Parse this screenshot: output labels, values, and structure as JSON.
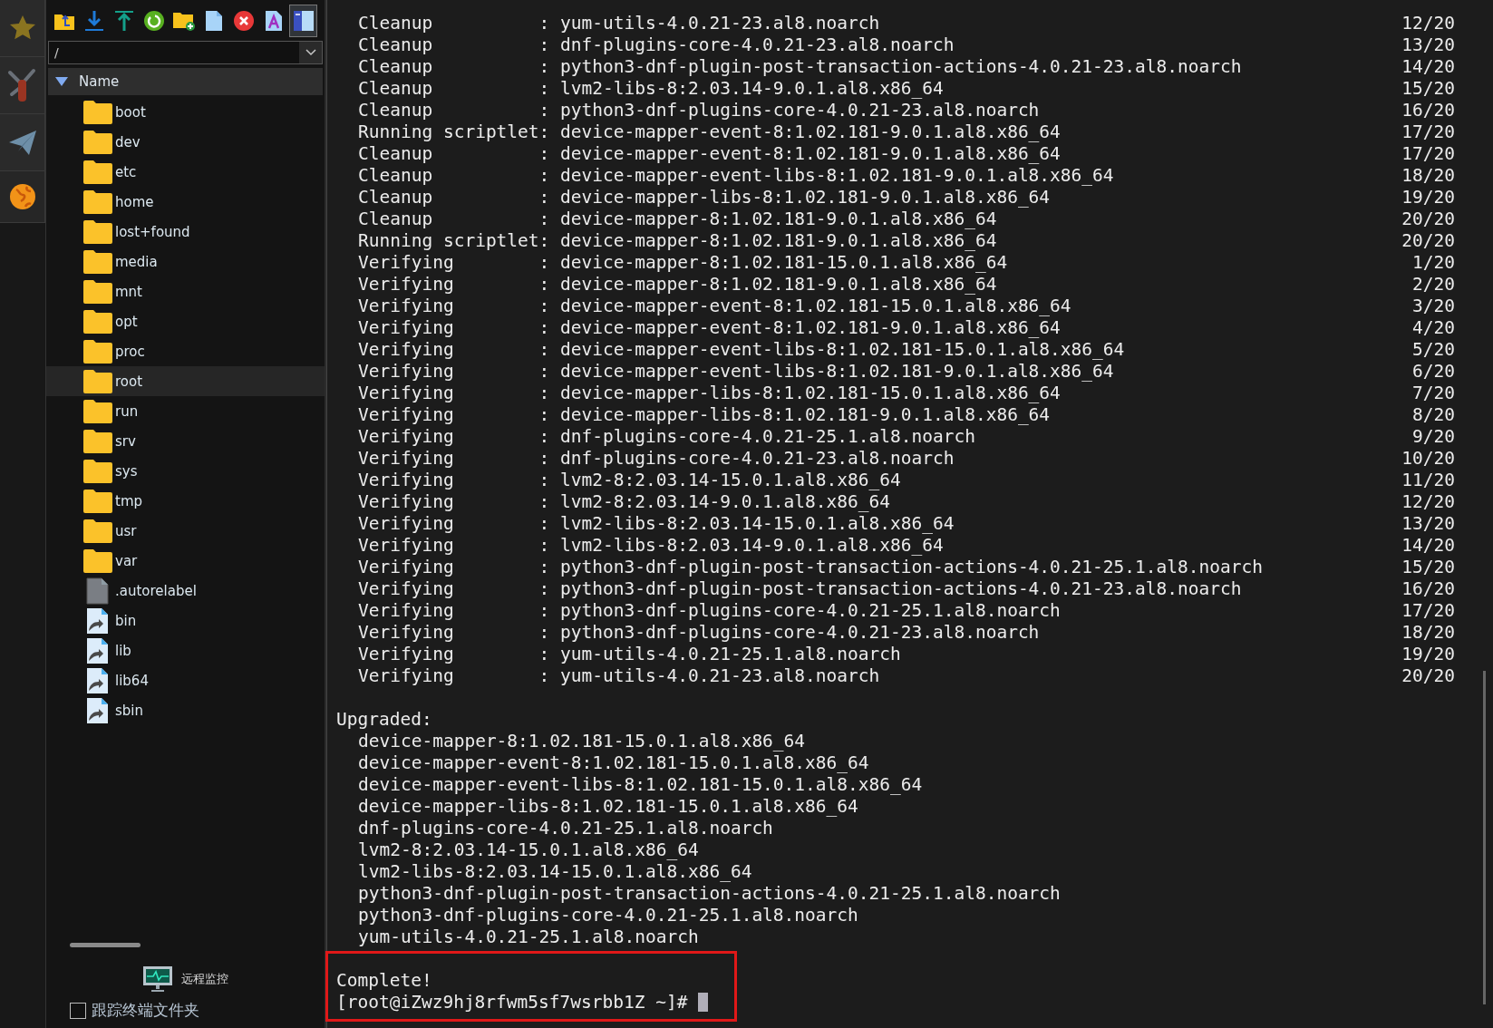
{
  "toolbar": [
    {
      "kind": "folder-up",
      "selected": false
    },
    {
      "kind": "download",
      "selected": false
    },
    {
      "kind": "upload",
      "selected": false
    },
    {
      "kind": "refresh",
      "selected": false
    },
    {
      "kind": "new-folder",
      "selected": false
    },
    {
      "kind": "new-file",
      "selected": false
    },
    {
      "kind": "delete",
      "selected": false
    },
    {
      "kind": "rename",
      "selected": false
    },
    {
      "kind": "panel",
      "selected": true
    }
  ],
  "path": {
    "value": "/"
  },
  "file_list": {
    "header": "Name",
    "items": [
      {
        "name": "boot",
        "kind": "folder",
        "selected": false
      },
      {
        "name": "dev",
        "kind": "folder",
        "selected": false
      },
      {
        "name": "etc",
        "kind": "folder",
        "selected": false
      },
      {
        "name": "home",
        "kind": "folder",
        "selected": false
      },
      {
        "name": "lost+found",
        "kind": "folder",
        "selected": false
      },
      {
        "name": "media",
        "kind": "folder",
        "selected": false
      },
      {
        "name": "mnt",
        "kind": "folder",
        "selected": false
      },
      {
        "name": "opt",
        "kind": "folder",
        "selected": false
      },
      {
        "name": "proc",
        "kind": "folder",
        "selected": false
      },
      {
        "name": "root",
        "kind": "folder",
        "selected": true
      },
      {
        "name": "run",
        "kind": "folder",
        "selected": false
      },
      {
        "name": "srv",
        "kind": "folder",
        "selected": false
      },
      {
        "name": "sys",
        "kind": "folder",
        "selected": false
      },
      {
        "name": "tmp",
        "kind": "folder",
        "selected": false
      },
      {
        "name": "usr",
        "kind": "folder",
        "selected": false
      },
      {
        "name": "var",
        "kind": "folder",
        "selected": false
      },
      {
        "name": ".autorelabel",
        "kind": "file",
        "selected": false
      },
      {
        "name": "bin",
        "kind": "link",
        "selected": false
      },
      {
        "name": "lib",
        "kind": "link",
        "selected": false
      },
      {
        "name": "lib64",
        "kind": "link",
        "selected": false
      },
      {
        "name": "sbin",
        "kind": "link",
        "selected": false
      }
    ]
  },
  "monitor": {
    "label": "远程监控"
  },
  "follow_terminal": {
    "label": "跟踪终端文件夹",
    "checked": false
  },
  "terminal": {
    "transactions": [
      {
        "line": "Cleanup          : yum-utils-4.0.21-23.al8.noarch",
        "count": "12/20"
      },
      {
        "line": "Cleanup          : dnf-plugins-core-4.0.21-23.al8.noarch",
        "count": "13/20"
      },
      {
        "line": "Cleanup          : python3-dnf-plugin-post-transaction-actions-4.0.21-23.al8.noarch",
        "count": "14/20"
      },
      {
        "line": "Cleanup          : lvm2-libs-8:2.03.14-9.0.1.al8.x86_64",
        "count": "15/20"
      },
      {
        "line": "Cleanup          : python3-dnf-plugins-core-4.0.21-23.al8.noarch",
        "count": "16/20"
      },
      {
        "line": "Running scriptlet: device-mapper-event-8:1.02.181-9.0.1.al8.x86_64",
        "count": "17/20"
      },
      {
        "line": "Cleanup          : device-mapper-event-8:1.02.181-9.0.1.al8.x86_64",
        "count": "17/20"
      },
      {
        "line": "Cleanup          : device-mapper-event-libs-8:1.02.181-9.0.1.al8.x86_64",
        "count": "18/20"
      },
      {
        "line": "Cleanup          : device-mapper-libs-8:1.02.181-9.0.1.al8.x86_64",
        "count": "19/20"
      },
      {
        "line": "Cleanup          : device-mapper-8:1.02.181-9.0.1.al8.x86_64",
        "count": "20/20"
      },
      {
        "line": "Running scriptlet: device-mapper-8:1.02.181-9.0.1.al8.x86_64",
        "count": "20/20"
      },
      {
        "line": "Verifying        : device-mapper-8:1.02.181-15.0.1.al8.x86_64",
        "count": "1/20"
      },
      {
        "line": "Verifying        : device-mapper-8:1.02.181-9.0.1.al8.x86_64",
        "count": "2/20"
      },
      {
        "line": "Verifying        : device-mapper-event-8:1.02.181-15.0.1.al8.x86_64",
        "count": "3/20"
      },
      {
        "line": "Verifying        : device-mapper-event-8:1.02.181-9.0.1.al8.x86_64",
        "count": "4/20"
      },
      {
        "line": "Verifying        : device-mapper-event-libs-8:1.02.181-15.0.1.al8.x86_64",
        "count": "5/20"
      },
      {
        "line": "Verifying        : device-mapper-event-libs-8:1.02.181-9.0.1.al8.x86_64",
        "count": "6/20"
      },
      {
        "line": "Verifying        : device-mapper-libs-8:1.02.181-15.0.1.al8.x86_64",
        "count": "7/20"
      },
      {
        "line": "Verifying        : device-mapper-libs-8:1.02.181-9.0.1.al8.x86_64",
        "count": "8/20"
      },
      {
        "line": "Verifying        : dnf-plugins-core-4.0.21-25.1.al8.noarch",
        "count": "9/20"
      },
      {
        "line": "Verifying        : dnf-plugins-core-4.0.21-23.al8.noarch",
        "count": "10/20"
      },
      {
        "line": "Verifying        : lvm2-8:2.03.14-15.0.1.al8.x86_64",
        "count": "11/20"
      },
      {
        "line": "Verifying        : lvm2-8:2.03.14-9.0.1.al8.x86_64",
        "count": "12/20"
      },
      {
        "line": "Verifying        : lvm2-libs-8:2.03.14-15.0.1.al8.x86_64",
        "count": "13/20"
      },
      {
        "line": "Verifying        : lvm2-libs-8:2.03.14-9.0.1.al8.x86_64",
        "count": "14/20"
      },
      {
        "line": "Verifying        : python3-dnf-plugin-post-transaction-actions-4.0.21-25.1.al8.noarch",
        "count": "15/20"
      },
      {
        "line": "Verifying        : python3-dnf-plugin-post-transaction-actions-4.0.21-23.al8.noarch",
        "count": "16/20"
      },
      {
        "line": "Verifying        : python3-dnf-plugins-core-4.0.21-25.1.al8.noarch",
        "count": "17/20"
      },
      {
        "line": "Verifying        : python3-dnf-plugins-core-4.0.21-23.al8.noarch",
        "count": "18/20"
      },
      {
        "line": "Verifying        : yum-utils-4.0.21-25.1.al8.noarch",
        "count": "19/20"
      },
      {
        "line": "Verifying        : yum-utils-4.0.21-23.al8.noarch",
        "count": "20/20"
      }
    ],
    "upgraded_heading": "Upgraded:",
    "upgraded": [
      "device-mapper-8:1.02.181-15.0.1.al8.x86_64",
      "device-mapper-event-8:1.02.181-15.0.1.al8.x86_64",
      "device-mapper-event-libs-8:1.02.181-15.0.1.al8.x86_64",
      "device-mapper-libs-8:1.02.181-15.0.1.al8.x86_64",
      "dnf-plugins-core-4.0.21-25.1.al8.noarch",
      "lvm2-8:2.03.14-15.0.1.al8.x86_64",
      "lvm2-libs-8:2.03.14-15.0.1.al8.x86_64",
      "python3-dnf-plugin-post-transaction-actions-4.0.21-25.1.al8.noarch",
      "python3-dnf-plugins-core-4.0.21-25.1.al8.noarch",
      "yum-utils-4.0.21-25.1.al8.noarch"
    ],
    "complete": "Complete!",
    "prompt": "[root@iZwz9hj8rfwm5sf7wsrbb1Z ~]#"
  }
}
